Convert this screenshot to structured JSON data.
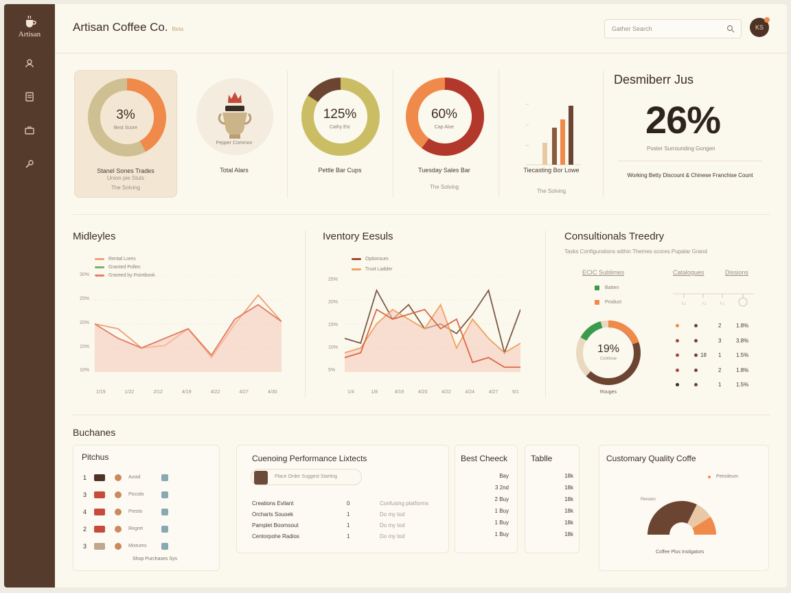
{
  "app": {
    "brand": "Artisan Coffee Co.",
    "brand_tag": "Beta",
    "logo_text": "Artisan"
  },
  "search": {
    "placeholder": "Gather Search"
  },
  "user": {
    "initials": "KS"
  },
  "colors": {
    "sidebar": "#553b2c",
    "accent_orange": "#f08a4b",
    "accent_tan": "#cbb98e",
    "accent_brown": "#6b4531",
    "accent_red": "#b3382c"
  },
  "kpis": [
    {
      "value": "3%",
      "sub": "Best Score",
      "label": "Stanel Sones Trades",
      "note": "Union pie Stuts",
      "note2": "The Solving",
      "fill": 0.42,
      "color_main": "#f08a4b",
      "color_track": "#cfc093"
    },
    {
      "label": "Total Alars",
      "sub": "Pepper Common"
    },
    {
      "value": "125%",
      "sub": "Cathy Etc",
      "label": "Pettle Bar Cups",
      "fill": 0.85,
      "color_main": "#cbbd63",
      "color_track": "#eedcc0"
    },
    {
      "value": "60%",
      "sub": "Cap Aloe",
      "label": "Tuesday Sales Bar",
      "note2": "The Solving",
      "fill": 0.6,
      "color_main": "#b3382c",
      "color_track": "#f08a4b"
    },
    {
      "label": "Tiecasting Bor Lowe",
      "note2": "The Solving"
    }
  ],
  "stat": {
    "title": "Desmiberr Jus",
    "value": "26%",
    "sub": "Poster Surrounding Gongen",
    "note": "Working Betty Discount & Chinese Franchise Count"
  },
  "panels": {
    "mixed": {
      "title": "Midleyles",
      "legend": [
        "Rental Lores",
        "Granted Pollen",
        "Granted by Pointbook"
      ],
      "y_ticks": [
        "30%",
        "25%",
        "20%",
        "15%",
        "10%"
      ],
      "x_ticks": [
        "1/19",
        "1/22",
        "2/12",
        "4/19",
        "4/22",
        "4/27",
        "4/30"
      ]
    },
    "inventory": {
      "title": "Iventory Eesuls",
      "legend": [
        "Optionsum",
        "Trust Ladder"
      ],
      "y_ticks": [
        "25%",
        "20%",
        "15%",
        "10%",
        "5%"
      ],
      "x_ticks": [
        "1/4",
        "1/8",
        "4/19",
        "4/20",
        "4/22",
        "4/24",
        "4/27",
        "5/1"
      ]
    },
    "consult": {
      "title": "Consultionals Treedry",
      "sub": "Tasks Configurations within Themes scores Pupalar Grand",
      "col_a": "ECIC Sublimes",
      "col_b": "Catalogues",
      "col_c": "Dissions",
      "legend": [
        "Batten",
        "Product"
      ],
      "ring_value": "19%",
      "ring_sub": "Continue",
      "ring_label": "Rouges",
      "ring_fill": 0.62,
      "rows": [
        {
          "a": "2",
          "b": "1.8%"
        },
        {
          "a": "3",
          "b": "3.8%"
        },
        {
          "a": "1",
          "b": "1.5%"
        },
        {
          "a": "2",
          "b": "1.8%"
        },
        {
          "a": "1",
          "b": "1.5%"
        }
      ],
      "row_markers": [
        "",
        "",
        "18",
        "",
        ""
      ]
    }
  },
  "bottom": {
    "title": "Buchanes",
    "pickup": {
      "title": "Pitchus",
      "rows": [
        "1",
        "3",
        "4",
        "2",
        "3"
      ],
      "labels": [
        "Avoid",
        "Piccolo",
        "Presto",
        "Regret",
        "Mixtures"
      ],
      "footer": "Shop Purchases Sys"
    },
    "perf": {
      "title": "Cuenoing Performance Lixtects",
      "button": "Place Order Suggest Starting",
      "rows": [
        {
          "name": "Creations Evilant",
          "n": "0",
          "c": "Confusing platforms"
        },
        {
          "name": "Orcharts Souoek",
          "n": "1",
          "c": "Do my tod"
        },
        {
          "name": "Pamplet Boomsout",
          "n": "1",
          "c": "Do my tod"
        },
        {
          "name": "Centorpohe Radios",
          "n": "1",
          "c": "Do my tod"
        }
      ]
    },
    "bestcheck": {
      "title": "Best Cheeck",
      "rows": [
        "Bay",
        "3 2nd",
        "2 Buy",
        "1 Buy",
        "1 Buy",
        "1 Buy"
      ]
    },
    "table": {
      "title": "Tablle",
      "rows": [
        "18k",
        "18k",
        "18k",
        "18k",
        "18k",
        "18k"
      ]
    },
    "quality": {
      "title": "Customary Quality Coffe",
      "legend": "Petroleum",
      "pie_label": "Pension",
      "footer": "Coffee Plus Instigators"
    }
  },
  "chart_data": [
    {
      "type": "line",
      "title": "Midleyles",
      "x": [
        "1/19",
        "1/22",
        "2/12",
        "4/19",
        "4/22",
        "4/27",
        "4/30"
      ],
      "ylim": [
        10,
        30
      ],
      "series": [
        {
          "name": "Rental Lores",
          "values": [
            20,
            19,
            15,
            15.5,
            19,
            13,
            20,
            26,
            20.5
          ],
          "color": "#f0a070"
        },
        {
          "name": "Granted by Pointbook",
          "values": [
            20,
            17,
            15,
            17,
            19,
            13.5,
            21,
            24,
            20.5
          ],
          "color": "#e07a62"
        }
      ]
    },
    {
      "type": "line",
      "title": "Iventory Eesuls",
      "x": [
        "1/4",
        "1/8",
        "4/19",
        "4/20",
        "4/22",
        "4/24",
        "4/27",
        "5/1"
      ],
      "ylim": [
        5,
        25
      ],
      "series": [
        {
          "name": "Optionsum",
          "values": [
            12,
            11,
            22,
            16,
            19,
            14,
            15,
            13,
            17,
            22,
            9,
            18
          ],
          "color": "#7a5a44"
        },
        {
          "name": "Trust Ladder",
          "values": [
            9,
            10,
            15,
            18,
            16,
            14,
            19,
            10,
            16,
            12,
            9,
            11
          ],
          "color": "#f0a060"
        },
        {
          "name": "",
          "values": [
            8,
            9,
            18,
            16,
            17,
            18,
            14,
            16,
            7,
            8,
            6,
            6
          ],
          "color": "#d96846"
        }
      ]
    }
  ]
}
